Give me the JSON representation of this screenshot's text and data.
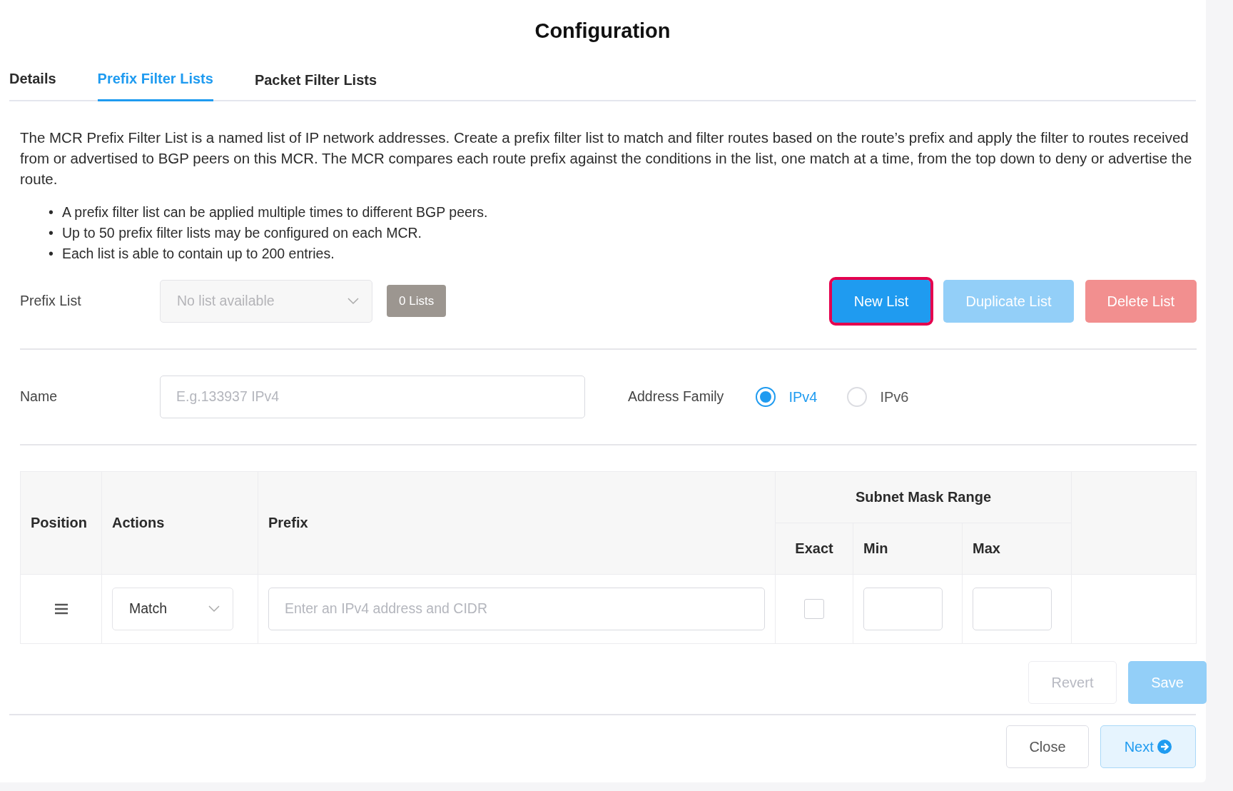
{
  "title": "Configuration",
  "tabs": [
    {
      "label": "Details",
      "selected": false
    },
    {
      "label": "Prefix Filter Lists",
      "selected": true
    },
    {
      "label": "Packet Filter Lists",
      "selected": false
    }
  ],
  "description": "The MCR Prefix Filter List is a named list of IP network addresses. Create a prefix filter list to match and filter routes based on the route’s prefix and apply the filter to routes received from or advertised to BGP peers on this MCR. The MCR compares each route prefix against the conditions in the list, one match at a time, from the top down to deny or advertise the route.",
  "bullets": [
    {
      "marker": "•",
      "text": "A prefix filter list can be applied multiple times to different BGP peers."
    },
    {
      "marker": "•",
      "text": "Up to 50 prefix filter lists may be configured on each MCR."
    },
    {
      "marker": "•",
      "text": "Each list is able to contain up to 200 entries."
    }
  ],
  "prefix_list": {
    "label": "Prefix List",
    "select": {
      "value": "No list available",
      "disabled": true
    },
    "count": "0 Lists"
  },
  "list_buttons": [
    {
      "label": "New List",
      "kind": "primary",
      "disabled": false,
      "highlighted": true
    },
    {
      "label": "Duplicate List",
      "kind": "primary",
      "disabled": true,
      "highlighted": false
    },
    {
      "label": "Delete List",
      "kind": "danger",
      "disabled": true,
      "highlighted": false
    }
  ],
  "name": {
    "label": "Name",
    "placeholder": "E.g.133937 IPv4"
  },
  "address_family": {
    "label": "Address Family",
    "options": [
      {
        "label": "IPv4",
        "selected": true
      },
      {
        "label": "IPv6",
        "selected": false
      }
    ]
  },
  "table": {
    "columns": [
      "Position",
      "Actions",
      "Prefix"
    ],
    "group_header": "Subnet Mask Range",
    "sub_columns": [
      "Exact",
      "Min",
      "Max"
    ],
    "rows": [
      {
        "action": "Match",
        "prefix_placeholder": "Enter an IPv4 address and CIDR",
        "exact_checked": false
      }
    ]
  },
  "form_buttons": [
    {
      "label": "Revert",
      "kind": "secondary",
      "disabled": true
    },
    {
      "label": "Save",
      "kind": "primary",
      "disabled": true
    }
  ],
  "footer_buttons": [
    {
      "label": "Close",
      "kind": "secondary",
      "disabled": false
    },
    {
      "label": "Next",
      "kind": "next",
      "disabled": false
    }
  ]
}
